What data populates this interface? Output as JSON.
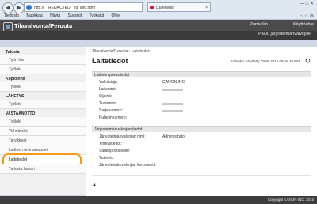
{
  "browser": {
    "address": "http://__REDACTED__/d_info.html",
    "tab_title": "Laitetiedot",
    "tab_close": "×",
    "back": "◀",
    "forward": "▶",
    "window_controls": "— □ ✕",
    "toolbar_icons": "⌂ ☆ ⚙",
    "menu": [
      "Tiedosto",
      "Muokkaa",
      "Näytä",
      "Suosikit",
      "Työkalut",
      "Ohje"
    ]
  },
  "header": {
    "title": "Tilavalvonta/Peruuta",
    "portal": "Portaaliin",
    "help": "Käyttöohje",
    "back_link": "Paluu järjestelmänvalvojille"
  },
  "sidebar": {
    "groups": [
      {
        "title": "Tulosta",
        "items": [
          "Työn tila",
          "Työloki"
        ]
      },
      {
        "title": "Kopioinnit",
        "items": [
          "Työloki"
        ]
      },
      {
        "title": "LÄHETYS",
        "items": [
          "Työloki"
        ]
      },
      {
        "title": "VASTAANOTTO",
        "items": [
          "Työloki"
        ]
      }
    ],
    "extra_items": [
      "Virhetiedot",
      "Tarvikkeet",
      "Laitteen ominaisuudet",
      "Laitetiedot",
      "Tarkista laskuri"
    ]
  },
  "main": {
    "breadcrumb": "Tilavalvonta/Peruuta : Laitetiedot",
    "title": "Laitetiedot",
    "updated": "Viimeksi päivitetty:29/06 2015 09:58 10 PM",
    "refresh_icon": "↻",
    "section1": {
      "title": "Laitteen perustiedot",
      "rows": [
        {
          "label": "Valmistaja:",
          "value": "CANON INC."
        },
        {
          "label": "Laitenimi:",
          "value": ""
        },
        {
          "label": "Sijainti:",
          "value": ""
        },
        {
          "label": "Tuotenimi:",
          "value": ""
        },
        {
          "label": "Sarjanumero:",
          "value": ""
        },
        {
          "label": "Puhelinnumero:",
          "value": ""
        }
      ]
    },
    "section2": {
      "title": "Järjestelmänvalvojan tiedot",
      "rows": [
        {
          "label": "Järjestelmänvalvojan nimi:",
          "value": "Administrator"
        },
        {
          "label": "Yhteystiedot:",
          "value": ""
        },
        {
          "label": "Sähköpostiosoite:",
          "value": ""
        },
        {
          "label": "Tutkinto:",
          "value": ""
        },
        {
          "label": "Järjestelmänvalvojan kommentti:",
          "value": ""
        }
      ]
    },
    "top_anchor": "▲"
  },
  "footer": {
    "copyright": "Copyright CANON INC. 2015"
  }
}
